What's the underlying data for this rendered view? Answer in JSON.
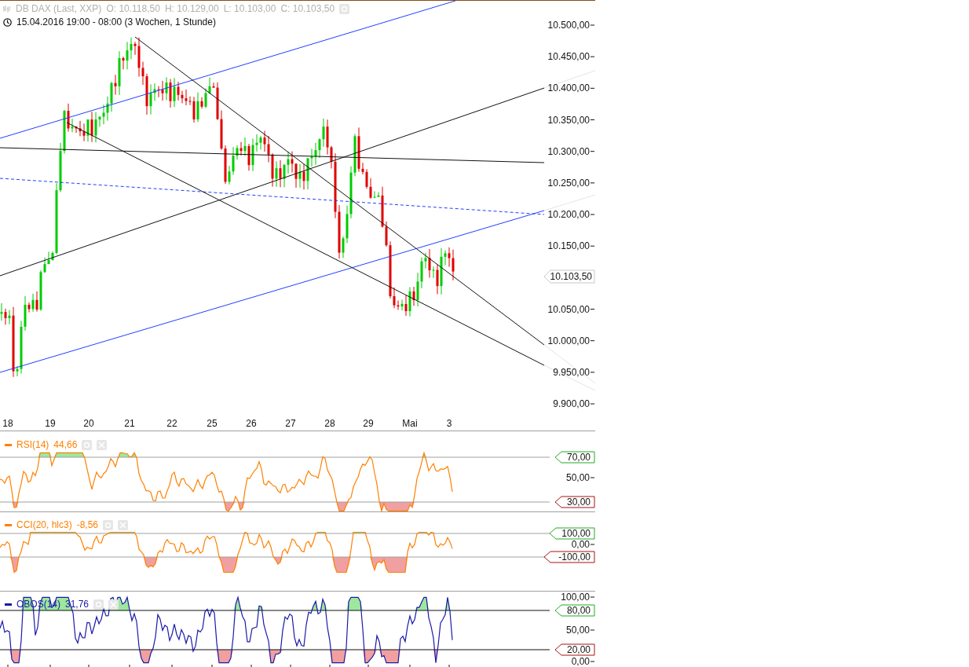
{
  "header": {
    "instrument": "DB DAX (Last, XXP)",
    "ohlc": [
      {
        "label": "O:",
        "value": "10.118,50"
      },
      {
        "label": "H:",
        "value": "10.129,00"
      },
      {
        "label": "L:",
        "value": "10.103,00"
      },
      {
        "label": "C:",
        "value": "10.103,50"
      }
    ],
    "range": "15.04.2016 19:00 - 08:00 (3 Wochen, 1 Stunde)"
  },
  "price_chart": {
    "y_labels": [
      "10.500,00",
      "10.450,00",
      "10.400,00",
      "10.350,00",
      "10.300,00",
      "10.250,00",
      "10.200,00",
      "10.150,00",
      "10.050,00",
      "10.000,00",
      "9.950,00",
      "9.900,00"
    ],
    "last_price": "10.103,50"
  },
  "x_axis": {
    "labels": [
      "18",
      "19",
      "20",
      "21",
      "22",
      "25",
      "26",
      "27",
      "28",
      "29",
      "Mai",
      "3"
    ]
  },
  "indicators": [
    {
      "kind": "rsi",
      "name": "RSI(14)",
      "value": "44,66",
      "color": "#ff8000",
      "levels": [
        {
          "label": "70,00",
          "kind": "upper"
        },
        {
          "label": "50,00",
          "kind": "tick"
        },
        {
          "label": "30,00",
          "kind": "lower"
        }
      ]
    },
    {
      "kind": "cci",
      "name": "CCI(20, hlc3)",
      "value": "-8,56",
      "color": "#ff8000",
      "levels": [
        {
          "label": "100,00",
          "kind": "upper"
        },
        {
          "label": "0,00",
          "kind": "tick"
        },
        {
          "label": "-100,00",
          "kind": "lower"
        }
      ]
    },
    {
      "kind": "obos",
      "name": "OBOS(14)",
      "value": "31,76",
      "color": "#1a1aa6",
      "levels": [
        {
          "label": "100,00",
          "kind": "tick"
        },
        {
          "label": "80,00",
          "kind": "upper"
        },
        {
          "label": "50,00",
          "kind": "tick"
        },
        {
          "label": "20,00",
          "kind": "lower"
        },
        {
          "label": "0,00",
          "kind": "tick"
        }
      ]
    }
  ]
}
